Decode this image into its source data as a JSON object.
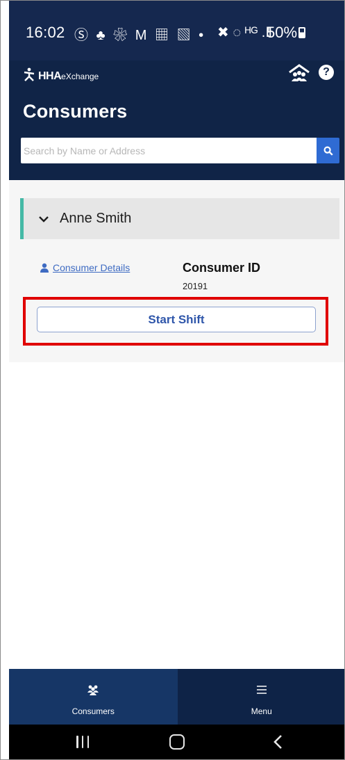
{
  "status_bar": {
    "time": "16:02",
    "notification_icons": "Ⓢ ♣ ❀ M ▦ ▧ •",
    "network_icons": "✖ ◌ ᴴᴳ .Ⅱ",
    "battery_percent": "50%"
  },
  "header": {
    "brand": "HHA",
    "brand_suffix": "eXchange",
    "title": "Consumers",
    "help_glyph": "?",
    "search_placeholder": "Search by Name or Address"
  },
  "consumer": {
    "name": "Anne Smith",
    "details_link": "Consumer Details",
    "id_label": "Consumer ID",
    "id_value": "20191",
    "start_button": "Start Shift"
  },
  "bottom_nav": {
    "items": [
      {
        "label": "Consumers",
        "icon": "users-icon",
        "active": true
      },
      {
        "label": "Menu",
        "icon": "hamburger-icon",
        "active": false
      }
    ]
  },
  "colors": {
    "header_bg": "#102447",
    "accent": "#2f6bd3",
    "highlight": "#e00000",
    "row_accent": "#45b9a6"
  }
}
